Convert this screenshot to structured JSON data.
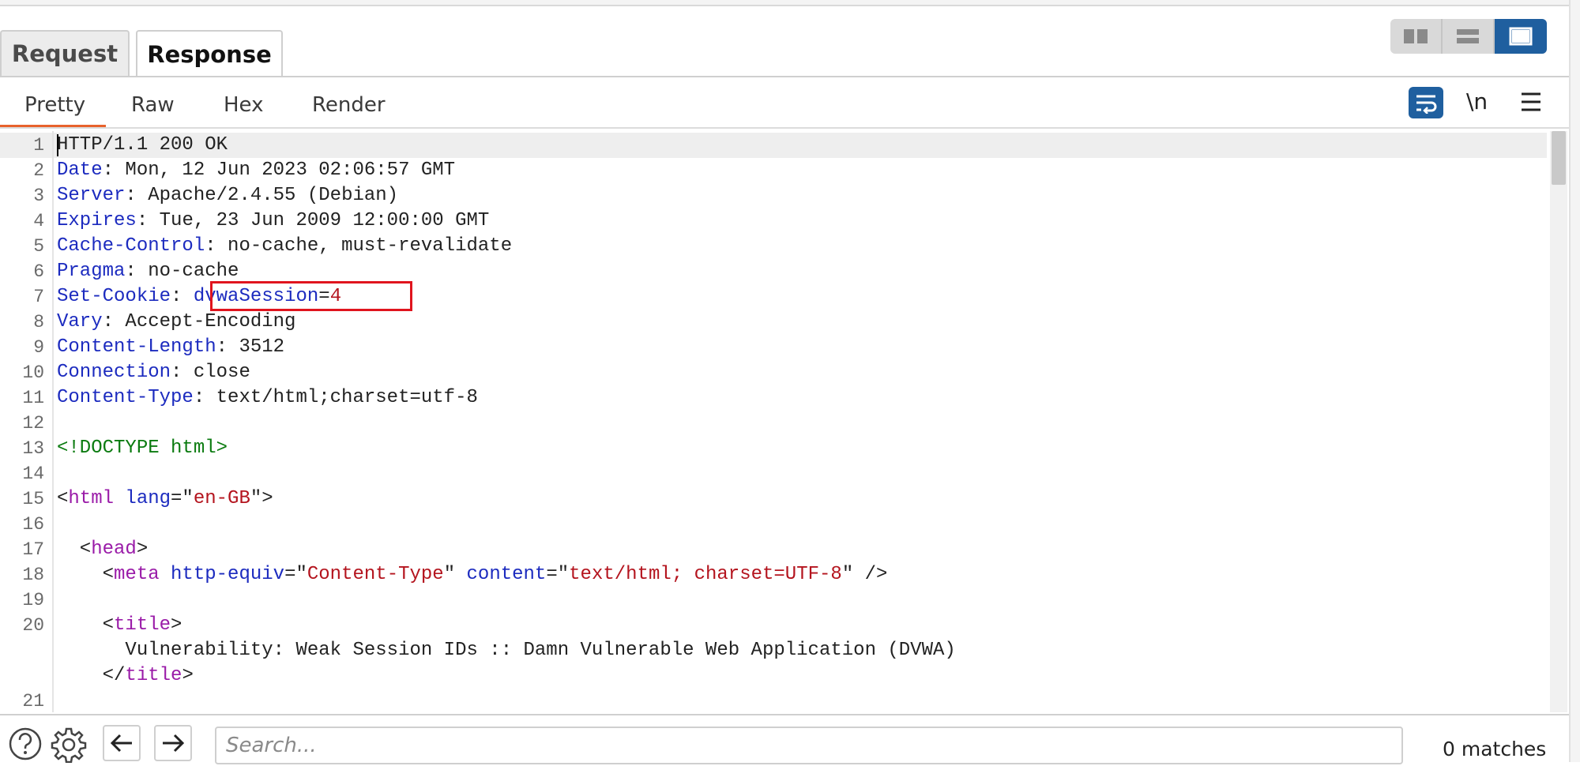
{
  "tabs": {
    "request": "Request",
    "response": "Response"
  },
  "view_tabs": [
    "Pretty",
    "Raw",
    "Hex",
    "Render"
  ],
  "toolbar": {
    "newline_label": "\\n"
  },
  "lines": [
    {
      "n": "1",
      "parts": [
        {
          "t": "HTTP/1.1 200 OK",
          "c": "pl"
        }
      ]
    },
    {
      "n": "2",
      "parts": [
        {
          "t": "Date",
          "c": "k"
        },
        {
          "t": ": Mon, 12 Jun 2023 02:06:57 GMT",
          "c": "v"
        }
      ]
    },
    {
      "n": "3",
      "parts": [
        {
          "t": "Server",
          "c": "k"
        },
        {
          "t": ": Apache/2.4.55 (Debian)",
          "c": "v"
        }
      ]
    },
    {
      "n": "4",
      "parts": [
        {
          "t": "Expires",
          "c": "k"
        },
        {
          "t": ": Tue, 23 Jun 2009 12:00:00 GMT",
          "c": "v"
        }
      ]
    },
    {
      "n": "5",
      "parts": [
        {
          "t": "Cache-Control",
          "c": "k"
        },
        {
          "t": ": no-cache, must-revalidate",
          "c": "v"
        }
      ]
    },
    {
      "n": "6",
      "parts": [
        {
          "t": "Pragma",
          "c": "k"
        },
        {
          "t": ": no-cache",
          "c": "v"
        }
      ]
    },
    {
      "n": "7",
      "parts": [
        {
          "t": "Set-Cookie",
          "c": "k"
        },
        {
          "t": ": ",
          "c": "v"
        },
        {
          "t": "dvwaSession",
          "c": "k"
        },
        {
          "t": "=",
          "c": "v"
        },
        {
          "t": "4",
          "c": "cv"
        }
      ]
    },
    {
      "n": "8",
      "parts": [
        {
          "t": "Vary",
          "c": "k"
        },
        {
          "t": ": Accept-Encoding",
          "c": "v"
        }
      ]
    },
    {
      "n": "9",
      "parts": [
        {
          "t": "Content-Length",
          "c": "k"
        },
        {
          "t": ": 3512",
          "c": "v"
        }
      ]
    },
    {
      "n": "10",
      "parts": [
        {
          "t": "Connection",
          "c": "k"
        },
        {
          "t": ": close",
          "c": "v"
        }
      ]
    },
    {
      "n": "11",
      "parts": [
        {
          "t": "Content-Type",
          "c": "k"
        },
        {
          "t": ": text/html;charset=utf-8",
          "c": "v"
        }
      ]
    },
    {
      "n": "12",
      "parts": []
    },
    {
      "n": "13",
      "parts": [
        {
          "t": "<!DOCTYPE html>",
          "c": "dt"
        }
      ]
    },
    {
      "n": "14",
      "parts": []
    },
    {
      "n": "15",
      "parts": [
        {
          "t": "<",
          "c": "pl"
        },
        {
          "t": "html",
          "c": "tg"
        },
        {
          "t": " ",
          "c": "pl"
        },
        {
          "t": "lang",
          "c": "at"
        },
        {
          "t": "=\"",
          "c": "pl"
        },
        {
          "t": "en-GB",
          "c": "av"
        },
        {
          "t": "\">",
          "c": "pl"
        }
      ]
    },
    {
      "n": "16",
      "parts": []
    },
    {
      "n": "17",
      "parts": [
        {
          "t": "  <",
          "c": "pl"
        },
        {
          "t": "head",
          "c": "tg"
        },
        {
          "t": ">",
          "c": "pl"
        }
      ]
    },
    {
      "n": "18",
      "parts": [
        {
          "t": "    <",
          "c": "pl"
        },
        {
          "t": "meta",
          "c": "tg"
        },
        {
          "t": " ",
          "c": "pl"
        },
        {
          "t": "http-equiv",
          "c": "at"
        },
        {
          "t": "=\"",
          "c": "pl"
        },
        {
          "t": "Content-Type",
          "c": "av"
        },
        {
          "t": "\" ",
          "c": "pl"
        },
        {
          "t": "content",
          "c": "at"
        },
        {
          "t": "=\"",
          "c": "pl"
        },
        {
          "t": "text/html; charset=UTF-8",
          "c": "av"
        },
        {
          "t": "\" />",
          "c": "pl"
        }
      ]
    },
    {
      "n": "19",
      "parts": []
    },
    {
      "n": "20",
      "parts": [
        {
          "t": "    <",
          "c": "pl"
        },
        {
          "t": "title",
          "c": "tg"
        },
        {
          "t": ">",
          "c": "pl"
        }
      ]
    },
    {
      "n": "",
      "parts": [
        {
          "t": "      Vulnerability: Weak Session IDs :: Damn Vulnerable Web Application (DVWA)",
          "c": "pl"
        }
      ]
    },
    {
      "n": "",
      "parts": [
        {
          "t": "    </",
          "c": "pl"
        },
        {
          "t": "title",
          "c": "tg"
        },
        {
          "t": ">",
          "c": "pl"
        }
      ]
    },
    {
      "n": "21",
      "parts": []
    }
  ],
  "search": {
    "placeholder": "Search...",
    "matches": "0 matches"
  }
}
